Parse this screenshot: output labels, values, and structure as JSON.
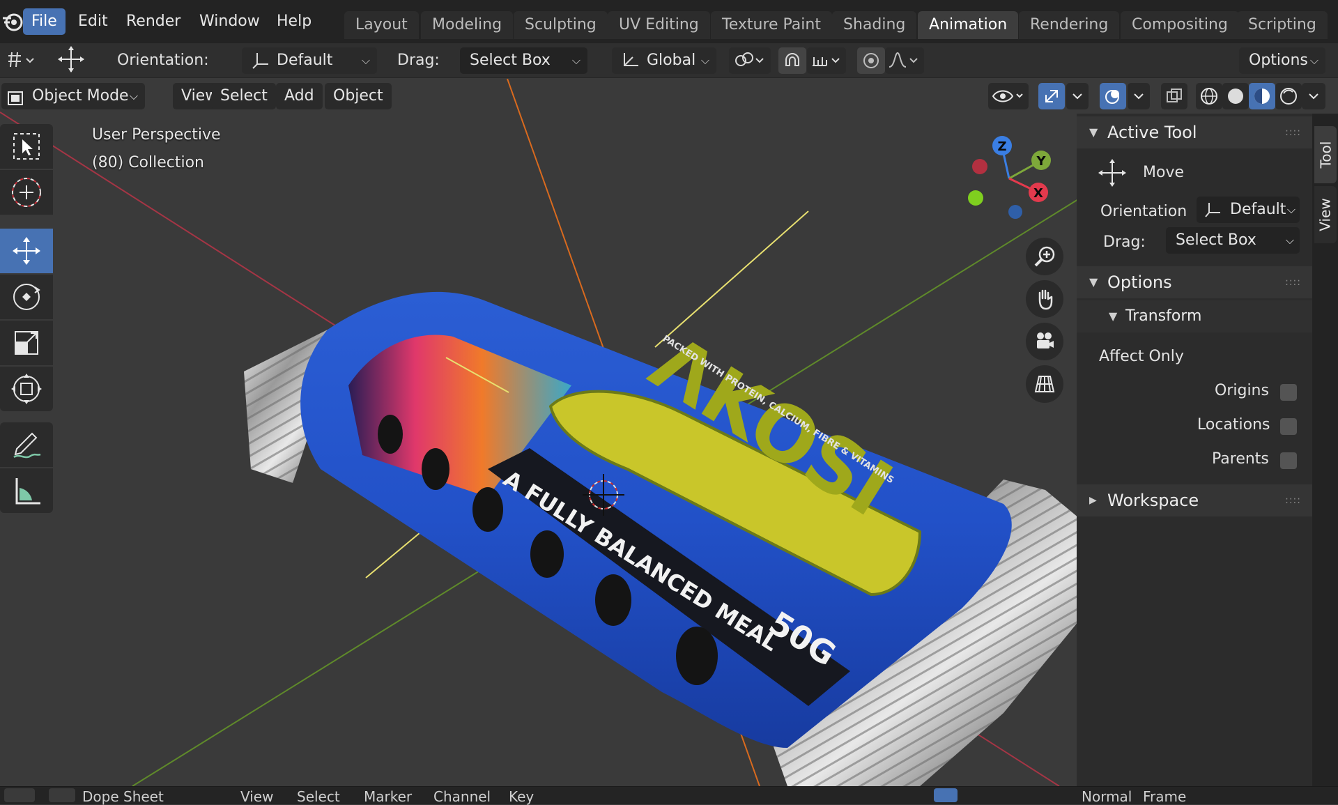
{
  "menu": {
    "items": [
      {
        "label": "File",
        "active": true
      },
      {
        "label": "Edit"
      },
      {
        "label": "Render"
      },
      {
        "label": "Window"
      },
      {
        "label": "Help"
      }
    ]
  },
  "workspaces": {
    "tabs": [
      {
        "label": "Layout"
      },
      {
        "label": "Modeling"
      },
      {
        "label": "Sculpting"
      },
      {
        "label": "UV Editing"
      },
      {
        "label": "Texture Paint"
      },
      {
        "label": "Shading"
      },
      {
        "label": "Animation",
        "active": true
      },
      {
        "label": "Rendering"
      },
      {
        "label": "Compositing"
      },
      {
        "label": "Scripting"
      }
    ]
  },
  "tool_settings": {
    "orientation_label": "Orientation:",
    "orientation_value": "Default",
    "drag_label": "Drag:",
    "drag_value": "Select Box",
    "transform_orientation": "Global",
    "options_label": "Options"
  },
  "viewport_header": {
    "mode": "Object Mode",
    "view": "View",
    "select": "Select",
    "add": "Add",
    "object": "Object"
  },
  "viewport": {
    "perspective": "User Perspective",
    "collection": "(80) Collection",
    "axes": {
      "x": "X",
      "y": "Y",
      "z": "Z"
    },
    "colors": {
      "x_axis": "#e33a4d",
      "y_axis": "#7ea83a",
      "z_axis": "#3a7ee3",
      "accent": "#4772b3"
    }
  },
  "scene": {
    "wrapper_brand": "ΛKOSI",
    "wrapper_tagline": "A FULLY BALANCED MEAL",
    "wrapper_weight": "50G",
    "wrapper_side_text": "PACKED WITH PROTEIN, CALCIUM, FIBRE & VITAMINS"
  },
  "npanel": {
    "active_tool_title": "Active Tool",
    "tool_name": "Move",
    "orientation_label": "Orientation",
    "orientation_value": "Default",
    "drag_label": "Drag:",
    "drag_value": "Select Box",
    "options_title": "Options",
    "transform_title": "Transform",
    "affect_only": "Affect Only",
    "origins": "Origins",
    "locations": "Locations",
    "parents": "Parents",
    "workspace_title": "Workspace"
  },
  "side_tabs": {
    "tool": "Tool",
    "view": "View"
  },
  "statusbar": {
    "left_a": "Dope Sheet",
    "left_b": "View",
    "left_c": "Select",
    "left_d": "Marker",
    "left_e": "Channel",
    "left_f": "Key",
    "right_a": "Normal",
    "right_b": "Frame"
  }
}
